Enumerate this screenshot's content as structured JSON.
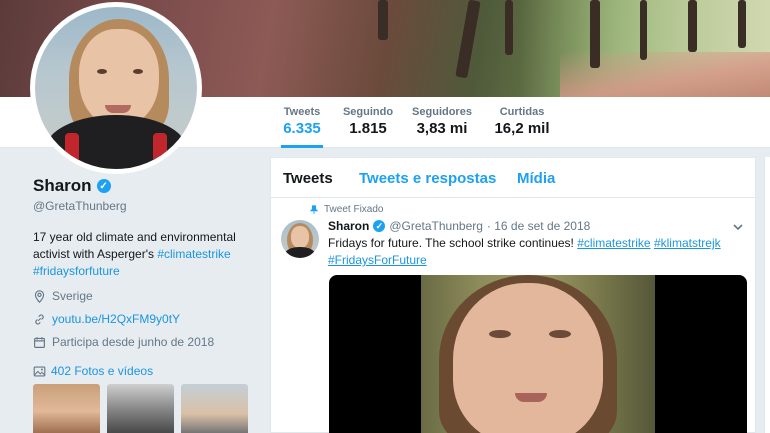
{
  "nav": {
    "stats": [
      {
        "label": "Tweets",
        "value": "6.335"
      },
      {
        "label": "Seguindo",
        "value": "1.815"
      },
      {
        "label": "Seguidores",
        "value": "3,83 mi"
      },
      {
        "label": "Curtidas",
        "value": "16,2 mil"
      }
    ]
  },
  "profile": {
    "name": "Sharon",
    "handle": "@GretaThunberg",
    "bio_text_1": "17 year old climate and environmental activist with Asperger's ",
    "bio_tag_1": "#climatestrike",
    "bio_tag_2": "#fridaysforfuture",
    "location": "Sverige",
    "website": "youtu.be/H2QxFM9y0tY",
    "joined": "Participa desde junho de 2018",
    "photos_label": "402 Fotos e vídeos"
  },
  "timeline": {
    "tabs": [
      "Tweets",
      "Tweets e respostas",
      "Mídia"
    ],
    "pinned_label": "Tweet Fixado",
    "tweet": {
      "name": "Sharon",
      "handle": "@GretaThunberg",
      "date": "· 16 de set de 2018",
      "text": "Fridays for future. The school strike continues! ",
      "tags": [
        "#climatestrike",
        "#klimatstrejk",
        "#FridaysForFuture"
      ]
    }
  },
  "colors": {
    "accent": "#1da1f2",
    "link": "#1b95e0",
    "muted": "#657786",
    "background": "#e6ecf0"
  },
  "icons": [
    "verified-badge-icon",
    "location-pin-icon",
    "link-icon",
    "calendar-icon",
    "photo-icon",
    "pin-icon",
    "chevron-down-icon"
  ]
}
